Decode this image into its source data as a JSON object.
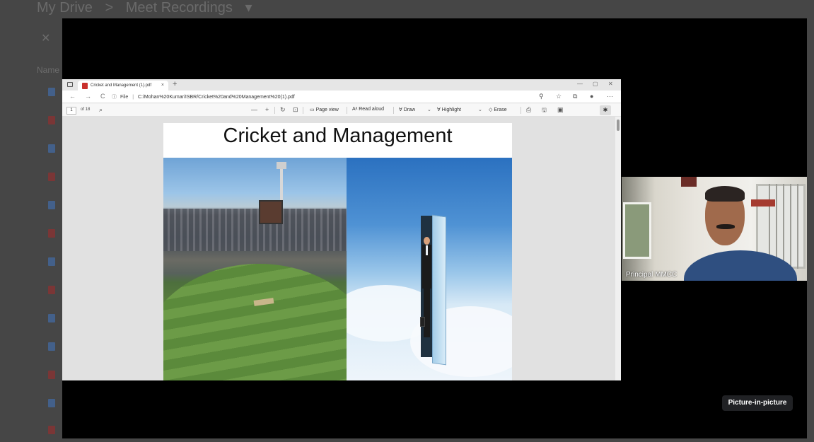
{
  "drive": {
    "breadcrumb_root": "My Drive",
    "breadcrumb_sep": ">",
    "breadcrumb_current": "Meet Recordings",
    "breadcrumb_caret": "▾",
    "close_glyph": "✕",
    "name_header": "Name"
  },
  "browser": {
    "tab_title": "Cricket and Management (1).pdf",
    "tab_close": "×",
    "new_tab": "+",
    "win_min": "—",
    "win_max": "▢",
    "win_close": "✕",
    "nav_back": "←",
    "nav_forward": "→",
    "nav_refresh": "C",
    "url_info_icon": "ⓘ",
    "url_label": "File",
    "url_sep": "|",
    "url": "C:/Mohan%20Kumar/ISBR/Cricket%20and%20Management%20(1).pdf",
    "addr_icons": [
      "⚲",
      "☆",
      "⧉",
      "●",
      "···"
    ]
  },
  "pdf_toolbar": {
    "page_current": "1",
    "page_total": "of 18",
    "search_icon": "⌕",
    "zoom_out": "—",
    "zoom_in": "+",
    "rotate": "↻",
    "fit": "⊡",
    "page_view": "Page view",
    "read_aloud": "Read aloud",
    "read_aloud_icon": "Aᵃ",
    "draw": "Draw",
    "draw_icon": "∀",
    "highlight": "Highlight",
    "highlight_icon": "∀",
    "erase": "Erase",
    "erase_icon": "◇",
    "dropdown": "⌄",
    "print_icon": "⎙",
    "save_icon": "🖫",
    "save_as_icon": "▣",
    "pin_icon": "✱"
  },
  "slide": {
    "title": "Cricket and Management"
  },
  "participant": {
    "name": "Principal MMCC"
  },
  "pip": {
    "label": "Picture-in-picture"
  }
}
